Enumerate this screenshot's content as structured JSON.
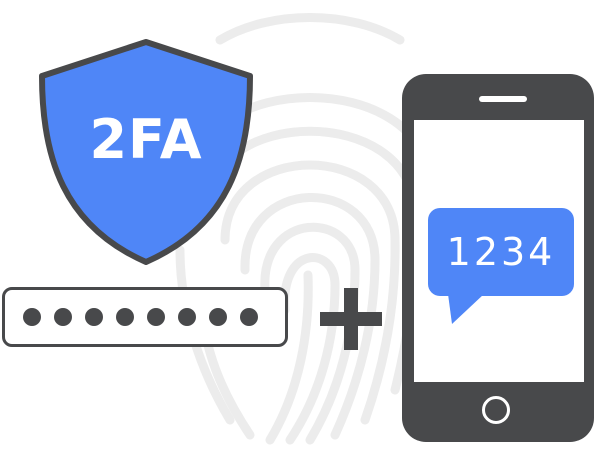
{
  "shield": {
    "label": "2FA",
    "icon": "shield-icon"
  },
  "password": {
    "dots": 8,
    "icon": "password-field"
  },
  "plus": {
    "icon": "plus-icon"
  },
  "phone": {
    "icon": "smartphone-icon",
    "message_code": "1234"
  },
  "background": {
    "icon": "fingerprint-icon"
  },
  "colors": {
    "accent_blue": "#4f86f7",
    "dark_gray": "#48494b",
    "fingerprint_gray": "#ededed"
  }
}
